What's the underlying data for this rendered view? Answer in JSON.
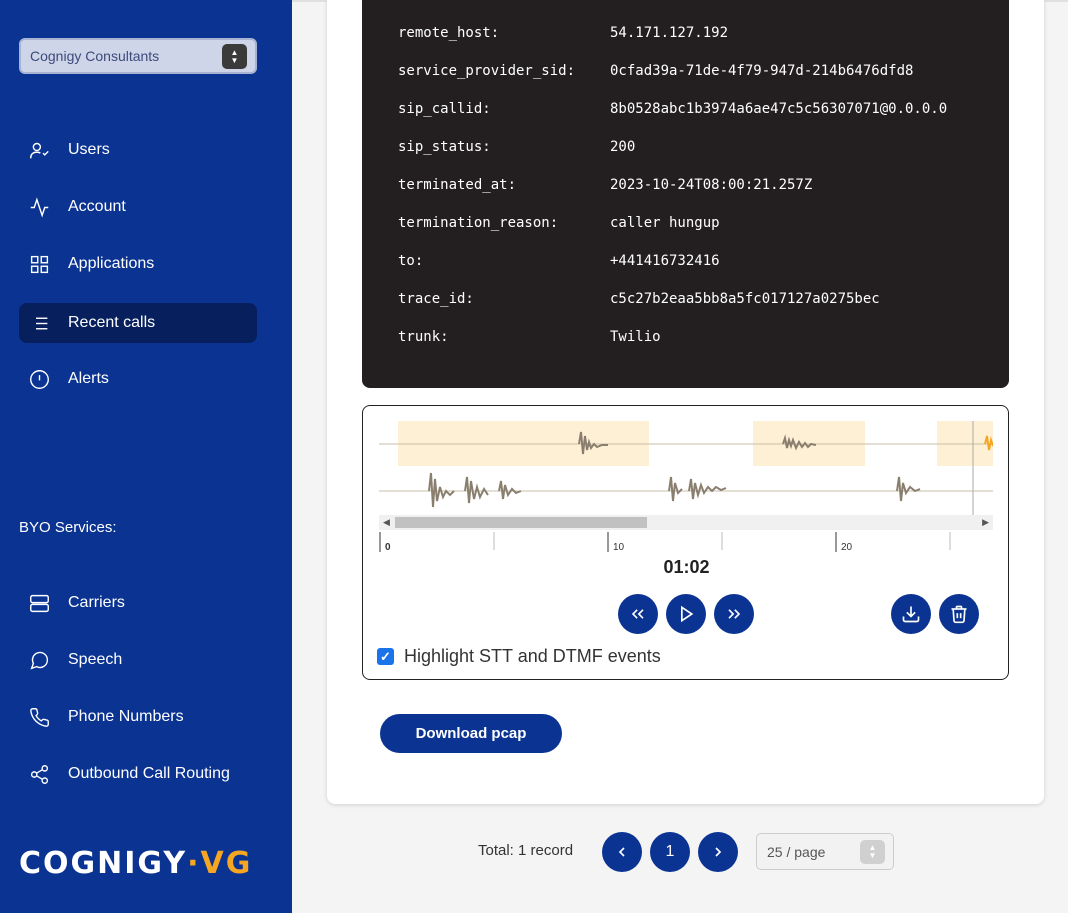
{
  "sidebar": {
    "account": "Cognigy Consultants",
    "items": [
      {
        "label": "Users",
        "icon": "user-check-icon"
      },
      {
        "label": "Account",
        "icon": "activity-icon"
      },
      {
        "label": "Applications",
        "icon": "grid-icon"
      },
      {
        "label": "Recent calls",
        "icon": "list-icon"
      },
      {
        "label": "Alerts",
        "icon": "alert-circle-icon"
      }
    ],
    "byo_label": "BYO Services:",
    "byo_items": [
      {
        "label": "Carriers",
        "icon": "server-icon"
      },
      {
        "label": "Speech",
        "icon": "message-circle-icon"
      },
      {
        "label": "Phone Numbers",
        "icon": "phone-icon"
      },
      {
        "label": "Outbound Call Routing",
        "icon": "share-icon"
      }
    ],
    "brand_main": "COGNIGY",
    "brand_dot": "·",
    "brand_suffix": "VG"
  },
  "details": [
    {
      "key": "remote_host:",
      "value": "54.171.127.192"
    },
    {
      "key": "service_provider_sid:",
      "value": "0cfad39a-71de-4f79-947d-214b6476dfd8"
    },
    {
      "key": "sip_callid:",
      "value": "8b0528abc1b3974a6ae47c5c56307071@0.0.0.0"
    },
    {
      "key": "sip_status:",
      "value": "200"
    },
    {
      "key": "terminated_at:",
      "value": "2023-10-24T08:00:21.257Z"
    },
    {
      "key": "termination_reason:",
      "value": "caller hungup"
    },
    {
      "key": "to:",
      "value": "+441416732416"
    },
    {
      "key": "trace_id:",
      "value": "c5c27b2eaa5bb8a5fc017127a0275bec"
    },
    {
      "key": "trunk:",
      "value": "Twilio"
    }
  ],
  "player": {
    "ticks": [
      "0",
      "10",
      "20"
    ],
    "time": "01:02",
    "highlight_label": "Highlight STT and DTMF events",
    "highlight_checked": true,
    "colors": {
      "wave": "#8a7f6e",
      "highlight": "#fdf0d5",
      "accent": "#f5a623"
    }
  },
  "download_pcap_label": "Download pcap",
  "pager": {
    "total": "Total: 1 record",
    "page": "1",
    "per_page": "25 / page"
  }
}
